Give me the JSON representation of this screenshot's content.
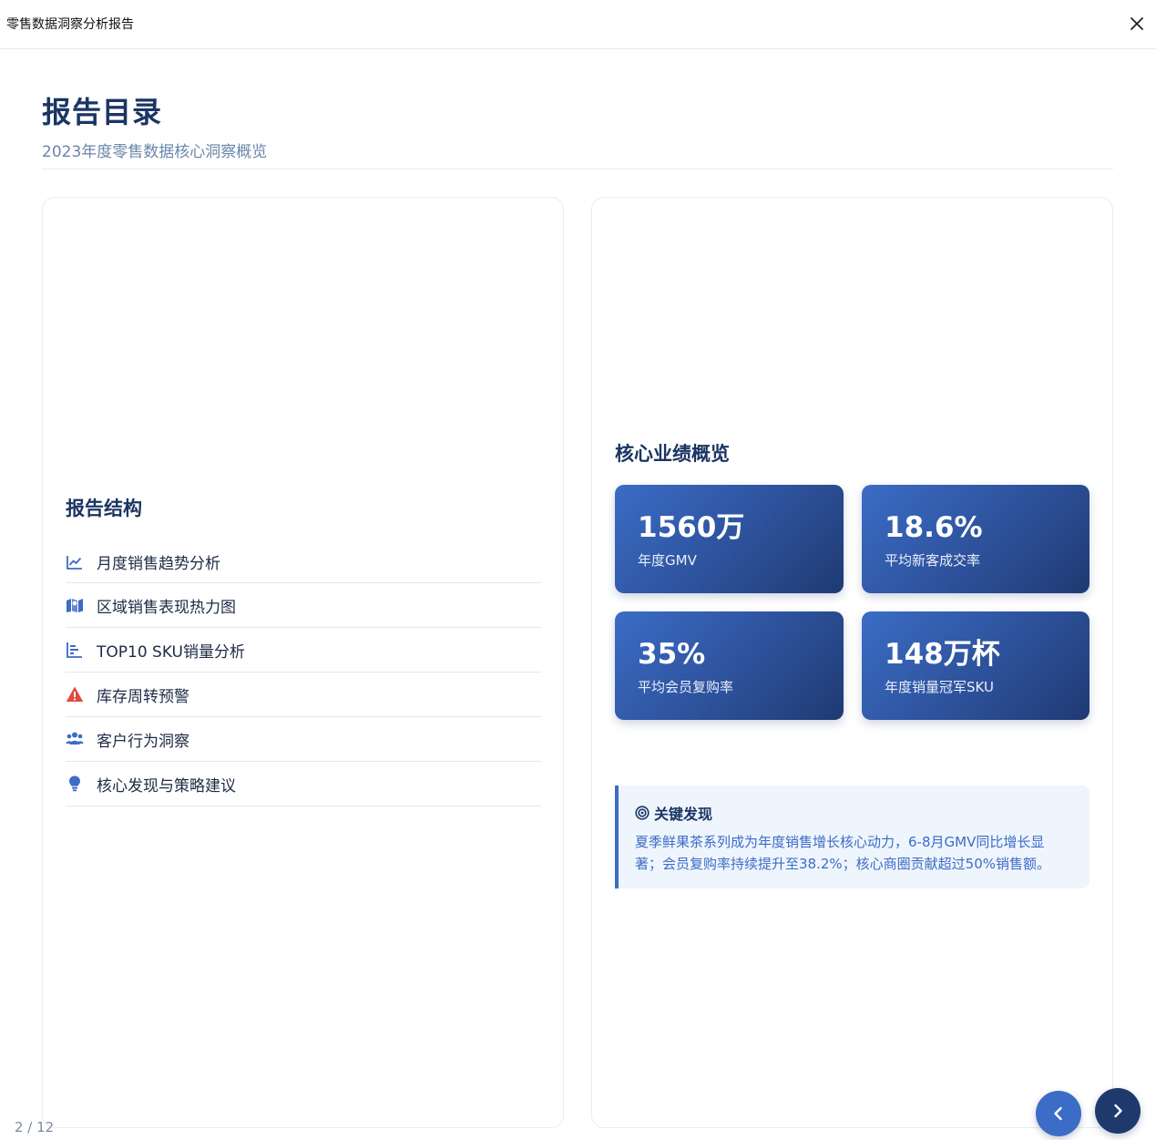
{
  "window": {
    "title": "零售数据洞察分析报告"
  },
  "header": {
    "title": "报告目录",
    "subtitle": "2023年度零售数据核心洞察概览"
  },
  "structure": {
    "title": "报告结构",
    "items": [
      {
        "label": "月度销售趋势分析",
        "icon": "line-chart-icon"
      },
      {
        "label": "区域销售表现热力图",
        "icon": "map-icon"
      },
      {
        "label": "TOP10 SKU销量分析",
        "icon": "bar-chart-icon"
      },
      {
        "label": "库存周转预警",
        "icon": "warning-icon"
      },
      {
        "label": "客户行为洞察",
        "icon": "users-icon"
      },
      {
        "label": "核心发现与策略建议",
        "icon": "lightbulb-icon"
      }
    ]
  },
  "overview": {
    "title": "核心业绩概览",
    "metrics": [
      {
        "value": "1560万",
        "label": "年度GMV"
      },
      {
        "value": "18.6%",
        "label": "平均新客成交率"
      },
      {
        "value": "35%",
        "label": "平均会员复购率"
      },
      {
        "value": "148万杯",
        "label": "年度销量冠军SKU"
      }
    ]
  },
  "finding": {
    "title": "关键发现",
    "icon": "target-icon",
    "text": "夏季鲜果茶系列成为年度销售增长核心动力，6-8月GMV同比增长显著；会员复购率持续提升至38.2%；核心商圈贡献超过50%销售额。"
  },
  "pagination": {
    "indicator": "2 / 12"
  },
  "colors": {
    "primary": "#3b6cc6",
    "navy": "#1b3564",
    "warning": "#e04a3f"
  }
}
